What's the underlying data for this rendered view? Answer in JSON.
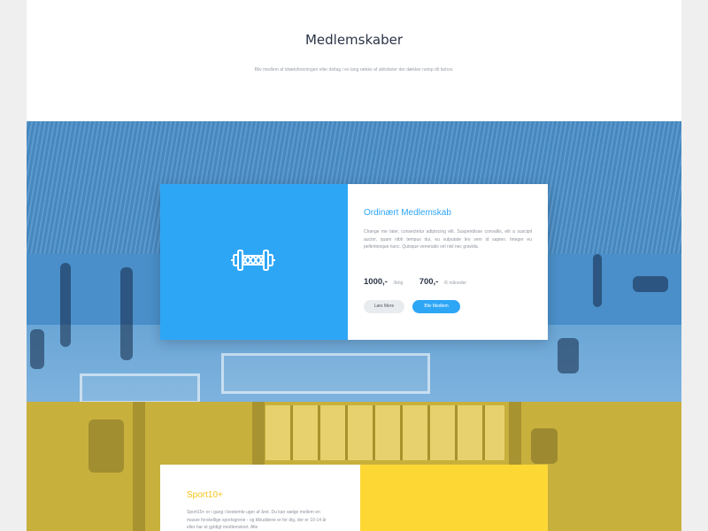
{
  "intro": {
    "title": "Medlemskaber",
    "subtitle": "Bliv medlem af idrætsforeningen eller deltag i en lang række af aktiviteter der dækker netop dit behov."
  },
  "membership_card": {
    "title": "Ordinært Medlemskab",
    "description": "Change me later, consectetur adipiscing elit. Suspendisse convallis, elit a suscipit auctor, quam nibh tempus dui, eu vulputate leo sem id sapien. Integer eu pellentesque nunc. Quisque venenatis vel nisl nec gravida.",
    "prices": [
      {
        "amount": "1000,-",
        "period": "/årlig"
      },
      {
        "amount": "700,-",
        "period": "/6 måneder"
      }
    ],
    "read_more_label": "Læs Mere",
    "join_label": "Bliv Medlem",
    "icon": "barbell-icon",
    "accent_color": "#2ea6f6"
  },
  "sport_card": {
    "title": "Sport10+",
    "description": "Sport10+ er i gang i bestemte uger af året. Du kan vælge mellem en masse forskellige sportsgrene - og tilbuddene er for dig, der er 10-14 år eller har et gyldigt medlemskort. Alle",
    "accent_color": "#fdd835"
  }
}
